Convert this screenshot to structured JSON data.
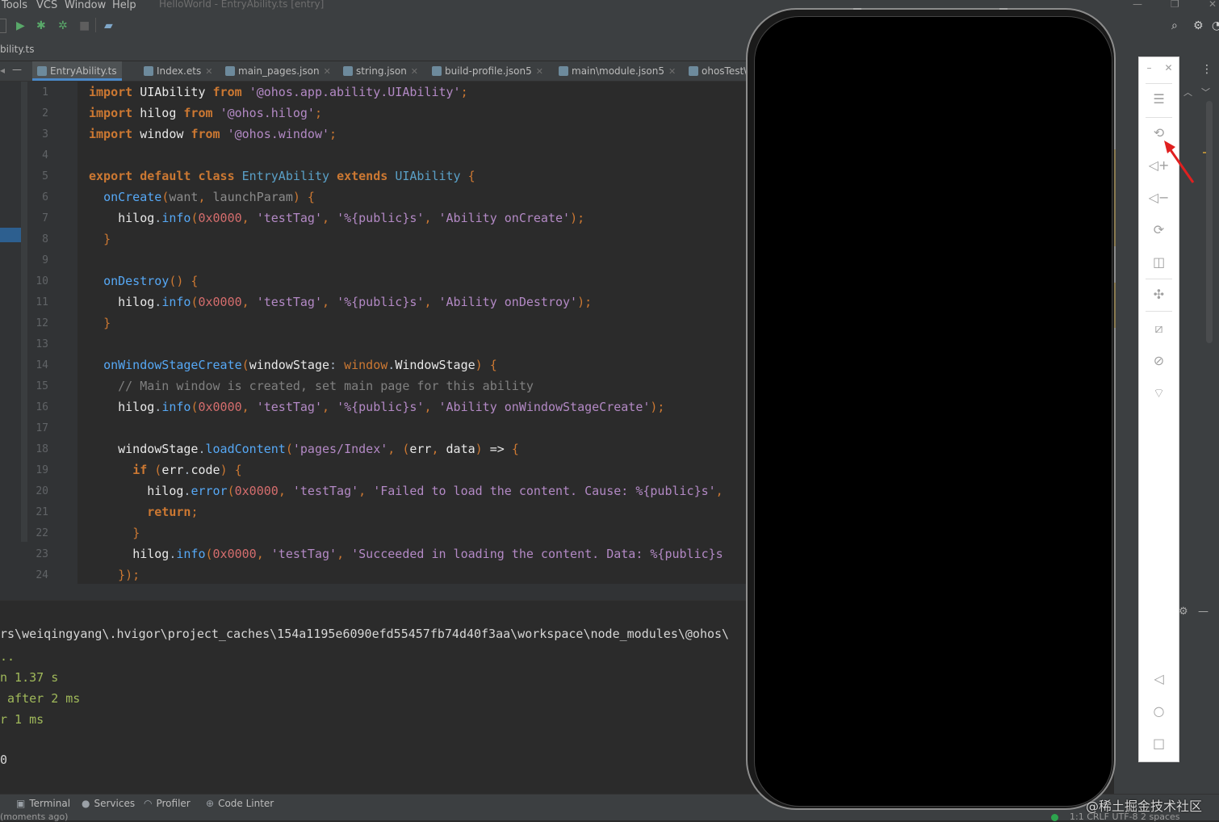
{
  "menubar": {
    "items": [
      "Tools",
      "VCS",
      "Window",
      "Help"
    ],
    "title": "HelloWorld - EntryAbility.ts [entry]"
  },
  "navbar": {
    "breadcrumb": "bility.ts"
  },
  "tabs": [
    {
      "label": "EntryAbility.ts",
      "active": true
    },
    {
      "label": "Index.ets"
    },
    {
      "label": "main_pages.json"
    },
    {
      "label": "string.json"
    },
    {
      "label": "build-profile.json5"
    },
    {
      "label": "main\\module.json5"
    },
    {
      "label": "ohosTest\\"
    }
  ],
  "editor": {
    "line_numbers": [
      "1",
      "2",
      "3",
      "4",
      "5",
      "6",
      "7",
      "8",
      "9",
      "10",
      "11",
      "12",
      "13",
      "14",
      "15",
      "16",
      "17",
      "18",
      "19",
      "20",
      "21",
      "22",
      "23",
      "24"
    ],
    "lines": [
      "import UIAbility from '@ohos.app.ability.UIAbility';",
      "import hilog from '@ohos.hilog';",
      "import window from '@ohos.window';",
      "",
      "export default class EntryAbility extends UIAbility {",
      "  onCreate(want, launchParam) {",
      "    hilog.info(0x0000, 'testTag', '%{public}s', 'Ability onCreate');",
      "  }",
      "",
      "  onDestroy() {",
      "    hilog.info(0x0000, 'testTag', '%{public}s', 'Ability onDestroy');",
      "  }",
      "",
      "  onWindowStageCreate(windowStage: window.WindowStage) {",
      "    // Main window is created, set main page for this ability",
      "    hilog.info(0x0000, 'testTag', '%{public}s', 'Ability onWindowStageCreate');",
      "",
      "    windowStage.loadContent('pages/Index', (err, data) => {",
      "      if (err.code) {",
      "        hilog.error(0x0000, 'testTag', 'Failed to load the content. Cause: %{public}s',",
      "        return;",
      "      }",
      "      hilog.info(0x0000, 'testTag', 'Succeeded in loading the content. Data: %{public}s",
      "    });"
    ]
  },
  "run_output": {
    "lines": [
      "rs\\weiqingyang\\.hvigor\\project_caches\\154a1195e6090efd55457fb74d40f3aa\\workspace\\node_modules\\@ohos\\",
      "..",
      "n 1.37 s",
      " after 2 ms",
      "r 1 ms",
      "",
      "0"
    ]
  },
  "statusbar": {
    "tools": [
      "Terminal",
      "Services",
      "Profiler",
      "Code Linter"
    ],
    "left_text": "(moments ago)",
    "right_text": "1:1  CRLF  UTF-8  2 spaces"
  },
  "emulator": {
    "icons": [
      "minimize-icon",
      "close-icon",
      "menu-icon",
      "rotate-left-icon",
      "volume-up-icon",
      "volume-down-icon",
      "rotate-right-icon",
      "screenshot-icon",
      "location-icon",
      "fold-icon",
      "fingerprint-icon",
      "wifi-off-icon",
      "back-icon",
      "home-icon",
      "recent-apps-icon"
    ]
  },
  "watermark": "@稀土掘金技术社区",
  "colors": {
    "accent": "#4a88c7",
    "editor_bg": "#2b2b2b",
    "arrow": "#e02020"
  }
}
